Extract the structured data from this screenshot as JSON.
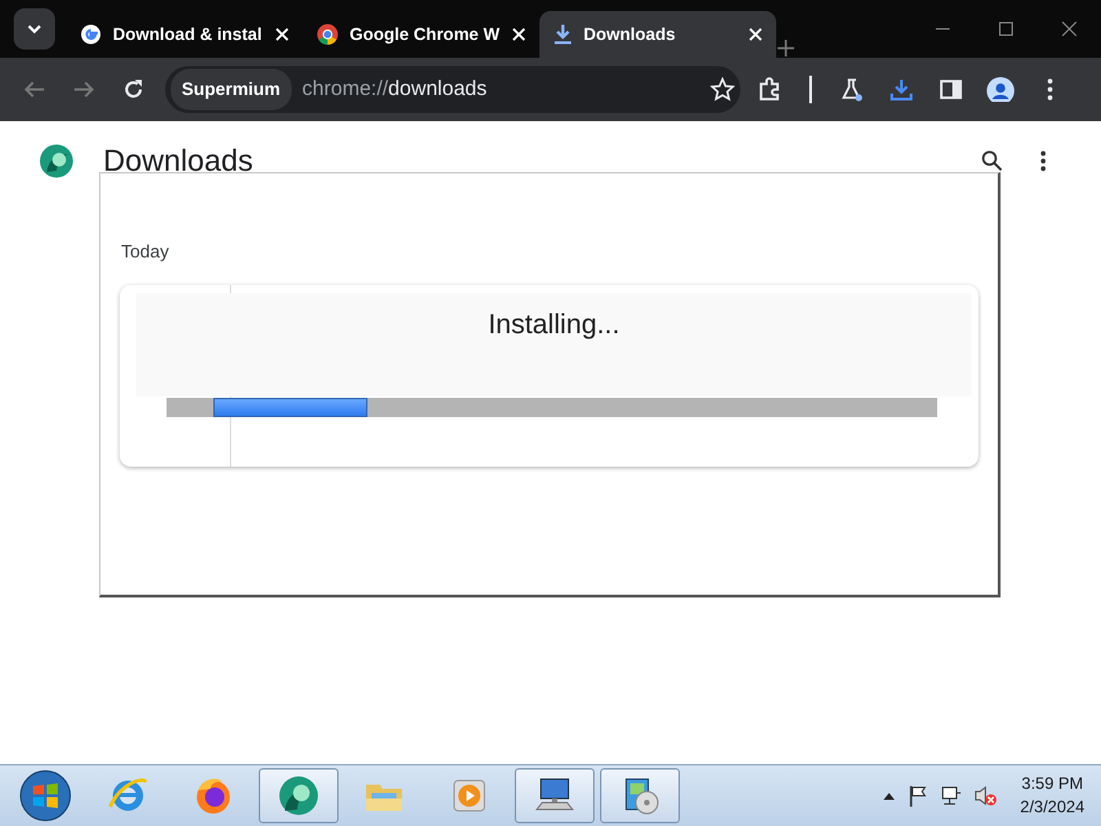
{
  "tabs": [
    {
      "title": "Download & instal",
      "kind": "google",
      "selected": false
    },
    {
      "title": "Google Chrome W",
      "kind": "chrome",
      "selected": false
    },
    {
      "title": "Downloads",
      "kind": "download",
      "selected": true
    }
  ],
  "address_bar": {
    "chip": "Supermium",
    "url_prefix": "chrome://",
    "url_path": "downloads"
  },
  "page": {
    "title": "Downloads",
    "section": "Today"
  },
  "installer": {
    "status": "Installing...",
    "level": 0.2
  },
  "taskbar": {
    "apps": [
      {
        "kind": "ie",
        "active": false
      },
      {
        "kind": "firefox",
        "active": false
      },
      {
        "kind": "browser",
        "active": true
      },
      {
        "kind": "explorer",
        "active": false
      },
      {
        "kind": "media",
        "active": false
      },
      {
        "kind": "keyboard",
        "active": true
      },
      {
        "kind": "setup",
        "active": true
      }
    ],
    "time": "3:59 PM",
    "date": "2/3/2024"
  }
}
